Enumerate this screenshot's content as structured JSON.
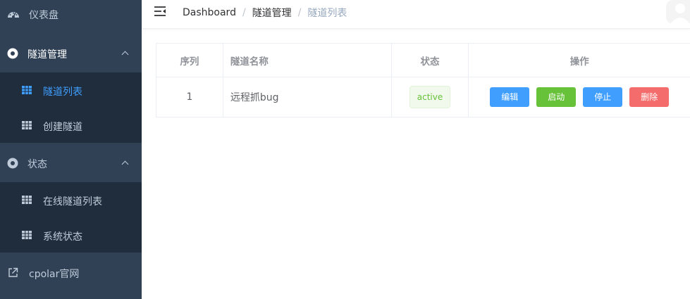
{
  "sidebar": {
    "items": [
      {
        "label": "仪表盘",
        "icon": "dashboard-icon"
      },
      {
        "label": "隧道管理",
        "icon": "circle-dot-icon"
      },
      {
        "label": "隧道列表",
        "icon": "table-icon"
      },
      {
        "label": "创建隧道",
        "icon": "table-icon"
      },
      {
        "label": "状态",
        "icon": "circle-dot-icon"
      },
      {
        "label": "在线隧道列表",
        "icon": "table-icon"
      },
      {
        "label": "系统状态",
        "icon": "table-icon"
      },
      {
        "label": "cpolar官网",
        "icon": "external-link-icon"
      }
    ]
  },
  "breadcrumb": [
    "Dashboard",
    "隧道管理",
    "隧道列表"
  ],
  "table": {
    "headers": [
      "序列",
      "隧道名称",
      "状态",
      "操作"
    ],
    "rows": [
      {
        "index": "1",
        "name": "远程抓bug",
        "status": "active"
      }
    ],
    "actions": [
      "编辑",
      "启动",
      "停止",
      "删除"
    ]
  },
  "colors": {
    "sidebar_bg": "#304156",
    "submenu_bg": "#1f2d3d",
    "accent": "#409eff",
    "success": "#67c23a",
    "danger": "#f56c6c"
  }
}
